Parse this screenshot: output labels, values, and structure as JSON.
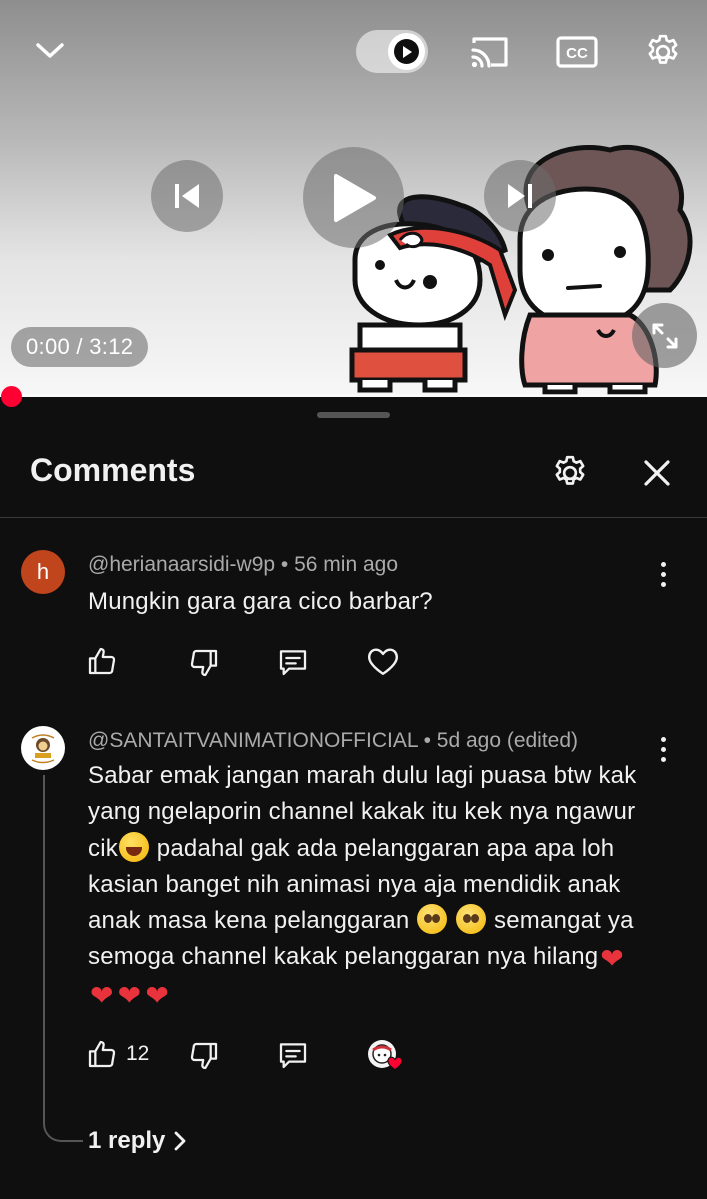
{
  "player": {
    "time_display": "0:00 / 3:12",
    "progress_fraction": 0.0
  },
  "comments_panel": {
    "title": "Comments"
  },
  "comments": [
    {
      "avatar_letter": "h",
      "avatar_color": "#c0441c",
      "author": "@herianaarsidi-w9p",
      "time": "56 min ago",
      "text": "Mungkin gara gara cico barbar?"
    },
    {
      "author": "@SANTAITVANIMATIONOFFICIAL",
      "time": "5d ago (edited)",
      "text_parts": {
        "p1": "Sabar emak jangan marah dulu lagi puasa btw kak yang ngelaporin channel kakak itu kek nya ngawur cik",
        "p2": " padahal gak ada pelanggaran apa apa loh kasian banget nih animasi nya aja mendidik anak anak masa kena pelanggaran ",
        "p3": " semangat ya semoga channel kakak pelanggaran nya hilang"
      },
      "like_count": "12",
      "replies_label": "1 reply"
    }
  ],
  "icons": {
    "collapse": "chevron-down-icon",
    "autoplay": "autoplay-toggle",
    "cast": "cast-icon",
    "captions": "cc-icon",
    "settings": "gear-icon",
    "prev": "skip-previous-icon",
    "play": "play-icon",
    "next": "skip-next-icon",
    "fullscreen": "fullscreen-icon",
    "close": "close-icon",
    "like": "thumb-up-icon",
    "dislike": "thumb-down-icon",
    "reply": "reply-icon",
    "heart": "heart-icon"
  },
  "colors": {
    "background": "#0f0f0f",
    "accent_red": "#ff0033",
    "secondary_text": "#aaaaaa"
  }
}
